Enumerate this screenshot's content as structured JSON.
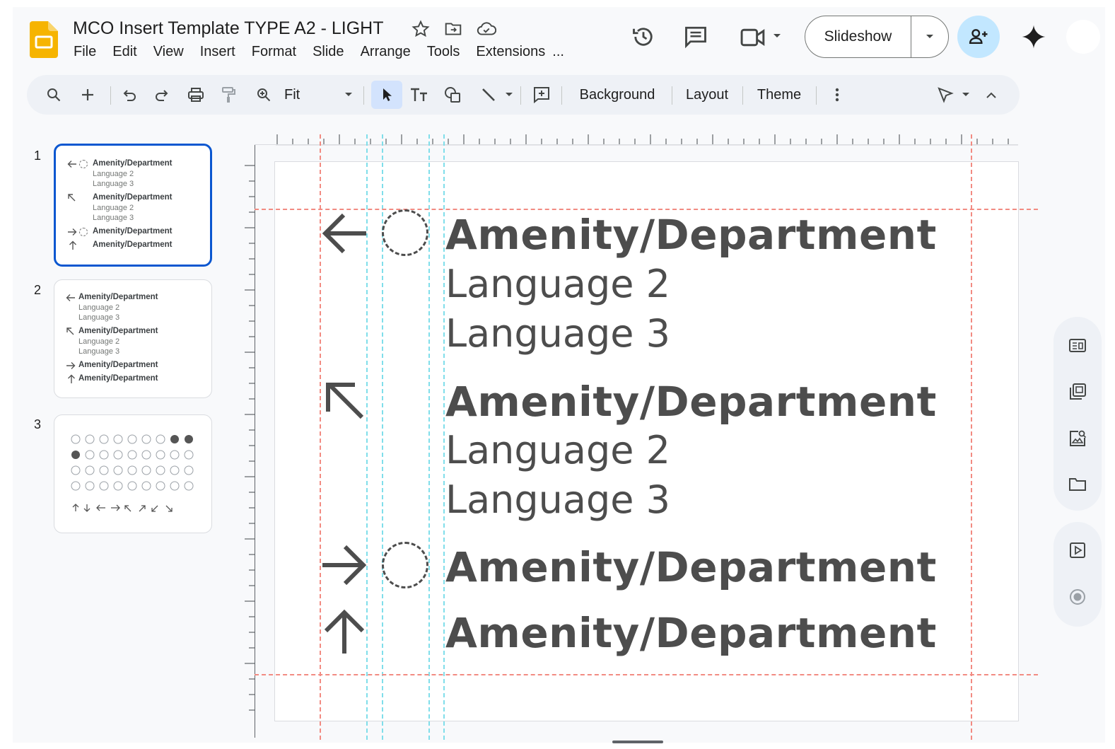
{
  "header": {
    "title": "MCO Insert Template TYPE A2 - LIGHT",
    "menu": [
      "File",
      "Edit",
      "View",
      "Insert",
      "Format",
      "Slide",
      "Arrange",
      "Tools",
      "Extensions",
      "..."
    ],
    "slideshow_label": "Slideshow"
  },
  "toolbar": {
    "zoom_label": "Fit",
    "background_label": "Background",
    "layout_label": "Layout",
    "theme_label": "Theme"
  },
  "filmstrip": {
    "slides": [
      {
        "number": "1",
        "lines": [
          "Amenity/Department",
          "Language 2",
          "Language 3",
          "Amenity/Department",
          "Language 2",
          "Language 3",
          "Amenity/Department",
          "Amenity/Department"
        ]
      },
      {
        "number": "2",
        "lines": [
          "Amenity/Department",
          "Language 2",
          "Language 3",
          "Amenity/Department",
          "Language 2",
          "Language 3",
          "Amenity/Department",
          "Amenity/Department"
        ]
      },
      {
        "number": "3"
      }
    ]
  },
  "slide": {
    "blocks": [
      {
        "icon": "arrow-left-icon",
        "title": "Amenity/Department",
        "line2": "Language 2",
        "line3": "Language 3"
      },
      {
        "icon": "arrow-up-left-icon",
        "title": "Amenity/Department",
        "line2": "Language 2",
        "line3": "Language 3"
      },
      {
        "icon": "arrow-right-icon",
        "title": "Amenity/Department"
      },
      {
        "icon": "arrow-up-icon",
        "title": "Amenity/Department"
      }
    ]
  },
  "colors": {
    "accent": "#0b57d0",
    "guide_red": "#f28b82",
    "guide_cyan": "#4dd0e1",
    "slide_text": "#4d4d4d",
    "share_bg": "#c2e7ff"
  }
}
